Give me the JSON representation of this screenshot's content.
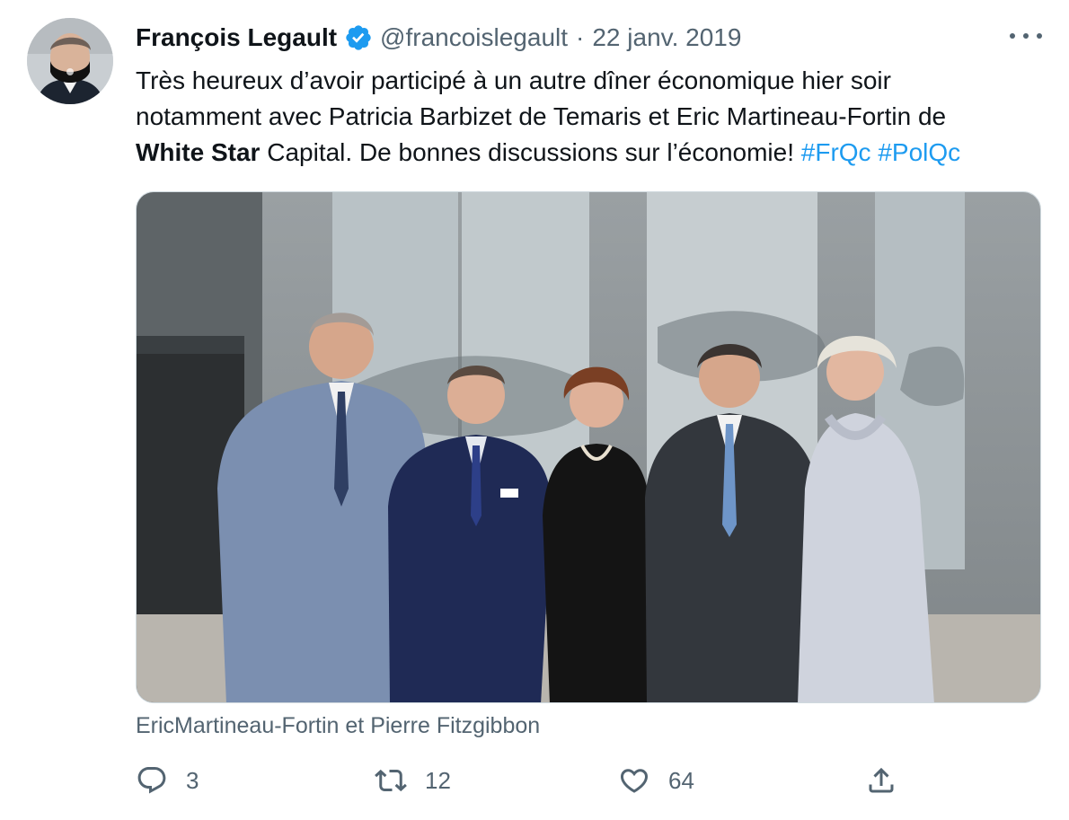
{
  "tweet": {
    "author_name": "François Legault",
    "handle": "@francoislegault",
    "separator": "·",
    "date": "22 janv. 2019",
    "text": {
      "line1": "Très heureux d’avoir participé à un autre dîner économique hier soir",
      "line2": "notamment avec Patricia Barbizet de Temaris et Eric Martineau-Fortin de",
      "line3_bold": "White Star",
      "line3_rest": " Capital. De bonnes discussions sur l’économie! ",
      "hashtag1": "#FrQc",
      "hashtag2": "#PolQc"
    },
    "caption": "EricMartineau-Fortin et Pierre Fitzgibbon"
  },
  "actions": {
    "replies": "3",
    "retweets": "12",
    "likes": "64"
  },
  "colors": {
    "accent": "#1d9bf0",
    "secondary_text": "#536471",
    "primary_text": "#0f1419"
  },
  "icons": [
    "verified-badge-icon",
    "more-icon",
    "reply-icon",
    "retweet-icon",
    "like-icon",
    "share-icon"
  ]
}
